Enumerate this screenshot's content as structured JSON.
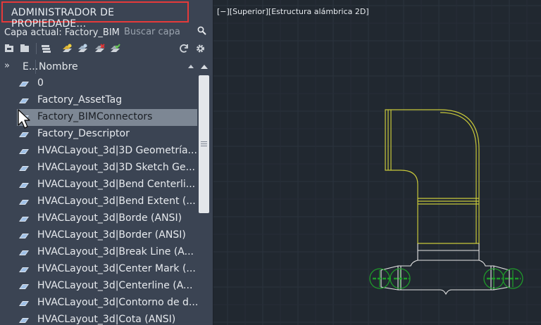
{
  "palette": {
    "title": "ADMINISTRADOR DE PROPIEDADE...",
    "current_layer": "Capa actual: Factory_BIM",
    "search_placeholder": "Buscar capa"
  },
  "toolbar": {
    "icons": [
      "new-property-filter-icon",
      "new-group-filter-icon",
      "layer-states-manager-icon",
      "new-layer-icon",
      "new-layer-vp-frozen-icon",
      "delete-layer-icon",
      "set-current-icon",
      "refresh-icon",
      "settings-icon"
    ]
  },
  "table": {
    "columns": {
      "status": "E...",
      "name": "Nombre"
    },
    "rows": [
      {
        "name": "0",
        "selected": false
      },
      {
        "name": "Factory_AssetTag",
        "selected": false
      },
      {
        "name": "Factory_BIMConnectors",
        "selected": true
      },
      {
        "name": "Factory_Descriptor",
        "selected": false
      },
      {
        "name": "HVACLayout_3d|3D  Geometría...",
        "selected": false
      },
      {
        "name": "HVACLayout_3d|3D Sketch Ge...",
        "selected": false
      },
      {
        "name": "HVACLayout_3d|Bend  Centerli...",
        "selected": false
      },
      {
        "name": "HVACLayout_3d|Bend Extent (...",
        "selected": false
      },
      {
        "name": "HVACLayout_3d|Borde (ANSI)",
        "selected": false
      },
      {
        "name": "HVACLayout_3d|Border (ANSI)",
        "selected": false
      },
      {
        "name": "HVACLayout_3d|Break Line (A...",
        "selected": false
      },
      {
        "name": "HVACLayout_3d|Center Mark (...",
        "selected": false
      },
      {
        "name": "HVACLayout_3d|Centerline  (A...",
        "selected": false
      },
      {
        "name": "HVACLayout_3d|Contorno de d...",
        "selected": false
      },
      {
        "name": "HVACLayout_3d|Cota (ANSI)",
        "selected": false
      }
    ]
  },
  "viewport": {
    "label": "[−][Superior][Estructura alámbrica 2D]"
  },
  "colors": {
    "panel_bg": "#3b4453",
    "viewport_bg": "#212830",
    "title_border": "#e53a3a",
    "selection": "#7d8794",
    "duct_yellow": "#c8c83a",
    "connector_green": "#1f9a2a",
    "drawing_white": "#e6e6e6"
  }
}
